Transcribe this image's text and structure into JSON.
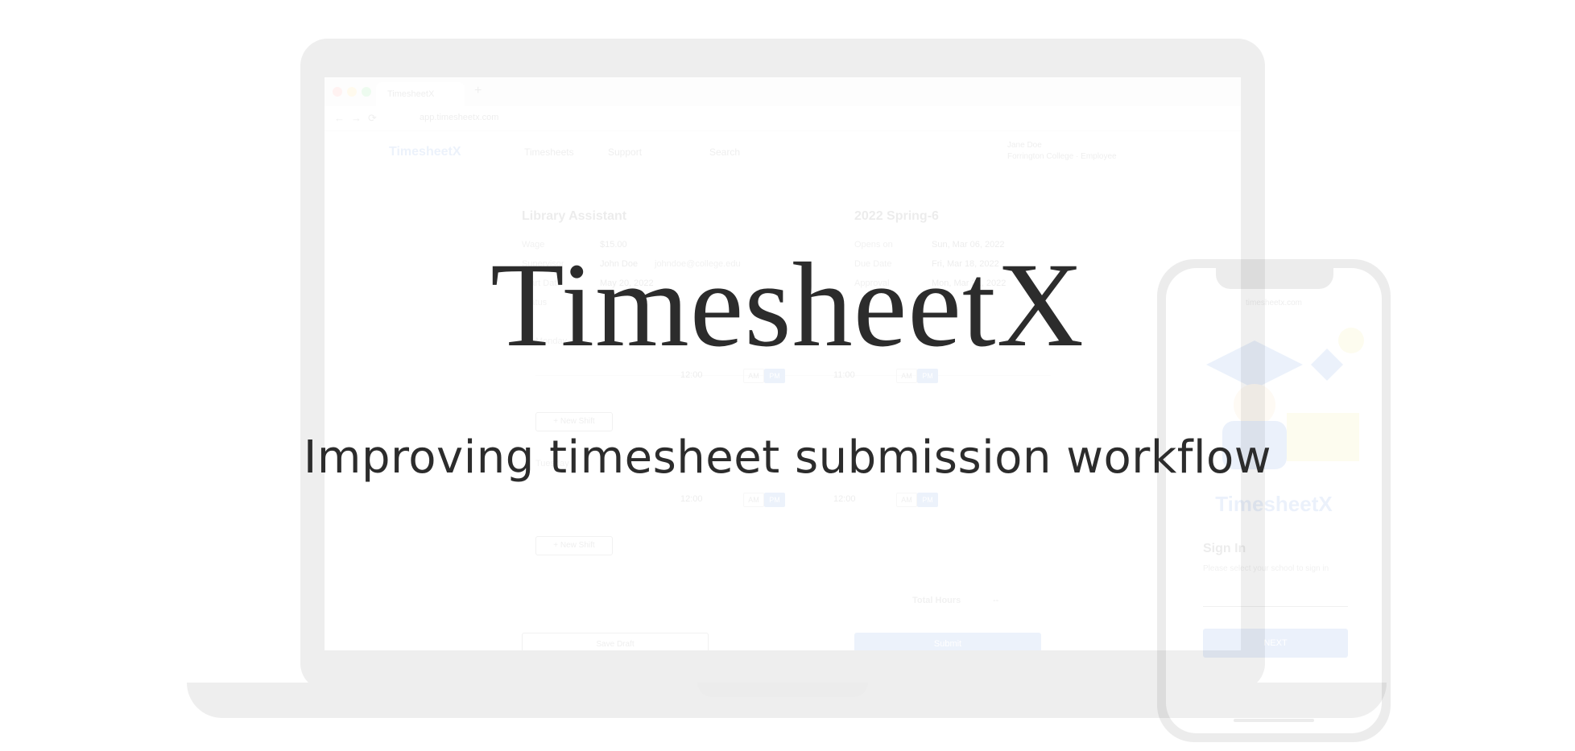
{
  "hero": {
    "title": "TimesheetX",
    "subtitle": "Improving timesheet submission workflow"
  },
  "browser": {
    "tab_label": "TimesheetX",
    "url": "app.timesheetx.com"
  },
  "app_nav": {
    "brand": "TimesheetX",
    "items": [
      "Timesheets",
      "Support",
      "Search"
    ],
    "user_name": "Jane Doe",
    "user_org": "Forrington College · Employee"
  },
  "job": {
    "title": "Library Assistant",
    "wage_label": "Wage",
    "wage_value": "$15.00",
    "supervisor_label": "Supervisor",
    "supervisor_value": "John Doe",
    "supervisor_email": "johndoe@college.edu",
    "start_label": "Start Date",
    "start_value": "May 20, 2022",
    "status_label": "Status"
  },
  "period": {
    "title": "2022 Spring-6",
    "opens_label": "Opens on",
    "opens_value": "Sun, Mar 06, 2022",
    "due_label": "Due Date",
    "due_value": "Fri, Mar 18, 2022",
    "third_label": "Approval",
    "third_value": "Mon, Mar 21, 2022"
  },
  "shifts": {
    "day1_label": "Monday",
    "day2_label": "Tuesday",
    "row1": {
      "start": "12:00",
      "end": "11:00"
    },
    "row2": {
      "start": "12:00",
      "end": "12:00"
    },
    "am": "AM",
    "pm": "PM",
    "new_shift": "+ New Shift"
  },
  "totals": {
    "label": "Total Hours",
    "value": "--"
  },
  "actions": {
    "save": "Save Draft",
    "submit": "Submit"
  },
  "phone": {
    "url": "timesheetx.com",
    "brand": "TimesheetX",
    "signin_title": "Sign In",
    "signin_hint": "Please select your school to sign in",
    "next": "NEXT"
  },
  "colors": {
    "accent": "#1f5ecc",
    "text": "#2c2c2c",
    "device": "#2f2f2f"
  }
}
